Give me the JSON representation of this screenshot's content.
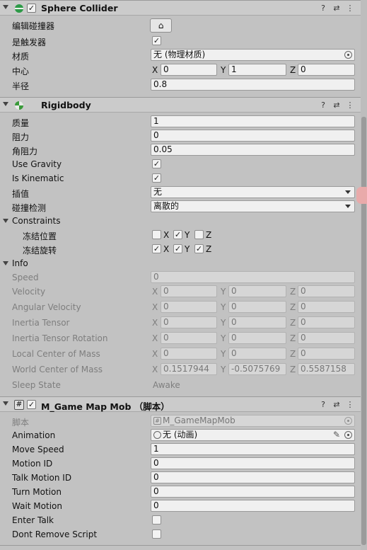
{
  "sphere_collider": {
    "title": "Sphere Collider",
    "edit_collider_label": "编辑碰撞器",
    "is_trigger_label": "是触发器",
    "is_trigger_check": "✓",
    "material_label": "材质",
    "material_value": "无 (物理材质)",
    "center_label": "中心",
    "center": {
      "x_axis": "X",
      "x": "0",
      "y_axis": "Y",
      "y": "1",
      "z_axis": "Z",
      "z": "0"
    },
    "radius_label": "半径",
    "radius_value": "0.8"
  },
  "rigidbody": {
    "title": "Rigidbody",
    "mass_label": "质量",
    "mass_value": "1",
    "drag_label": "阻力",
    "drag_value": "0",
    "angular_drag_label": "角阻力",
    "angular_drag_value": "0.05",
    "use_gravity_label": "Use Gravity",
    "use_gravity_check": "✓",
    "is_kinematic_label": "Is Kinematic",
    "is_kinematic_check": "✓",
    "interpolate_label": "插值",
    "interpolate_value": "无",
    "collision_detection_label": "碰撞检测",
    "collision_detection_value": "离散的",
    "constraints_label": "Constraints",
    "freeze_position_label": "冻结位置",
    "freeze_position": {
      "x": "X",
      "x_check": "",
      "y": "Y",
      "y_check": "✓",
      "z": "Z",
      "z_check": ""
    },
    "freeze_rotation_label": "冻结旋转",
    "freeze_rotation": {
      "x": "X",
      "x_check": "✓",
      "y": "Y",
      "y_check": "✓",
      "z": "Z",
      "z_check": "✓"
    },
    "info_label": "Info",
    "speed_label": "Speed",
    "speed_value": "0",
    "velocity_label": "Velocity",
    "velocity": {
      "x": "0",
      "y": "0",
      "z": "0"
    },
    "angular_velocity_label": "Angular Velocity",
    "angular_velocity": {
      "x": "0",
      "y": "0",
      "z": "0"
    },
    "inertia_tensor_label": "Inertia Tensor",
    "inertia_tensor": {
      "x": "0",
      "y": "0",
      "z": "0"
    },
    "inertia_tensor_rotation_label": "Inertia Tensor Rotation",
    "inertia_tensor_rotation": {
      "x": "0",
      "y": "0",
      "z": "0"
    },
    "local_com_label": "Local Center of Mass",
    "local_com": {
      "x": "0",
      "y": "0",
      "z": "0"
    },
    "world_com_label": "World Center of Mass",
    "world_com": {
      "x": "0.1517944",
      "y": "-0.5075769",
      "z": "0.5587158"
    },
    "sleep_state_label": "Sleep State",
    "sleep_state_value": "Awake"
  },
  "script": {
    "title": "M_Game Map Mob （脚本）",
    "script_label": "脚本",
    "script_value": "M_GameMapMob",
    "animation_label": "Animation",
    "animation_value": "无 (动画)",
    "move_speed_label": "Move Speed",
    "move_speed_value": "1",
    "motion_id_label": "Motion ID",
    "motion_id_value": "0",
    "talk_motion_id_label": "Talk Motion ID",
    "talk_motion_id_value": "0",
    "turn_motion_label": "Turn Motion",
    "turn_motion_value": "0",
    "wait_motion_label": "Wait Motion",
    "wait_motion_value": "0",
    "enter_talk_label": "Enter Talk",
    "enter_talk_check": "",
    "dont_remove_label": "Dont Remove Script",
    "dont_remove_check": ""
  },
  "axes": {
    "x": "X",
    "y": "Y",
    "z": "Z"
  },
  "header_buttons": {
    "help": "?",
    "preset": "⇄",
    "menu": "⋮"
  },
  "icons": {
    "edit": "⌂"
  },
  "colors": {
    "sphere_icon": "#2e9a48",
    "rigidbody_icon": "#3a9a3a"
  }
}
